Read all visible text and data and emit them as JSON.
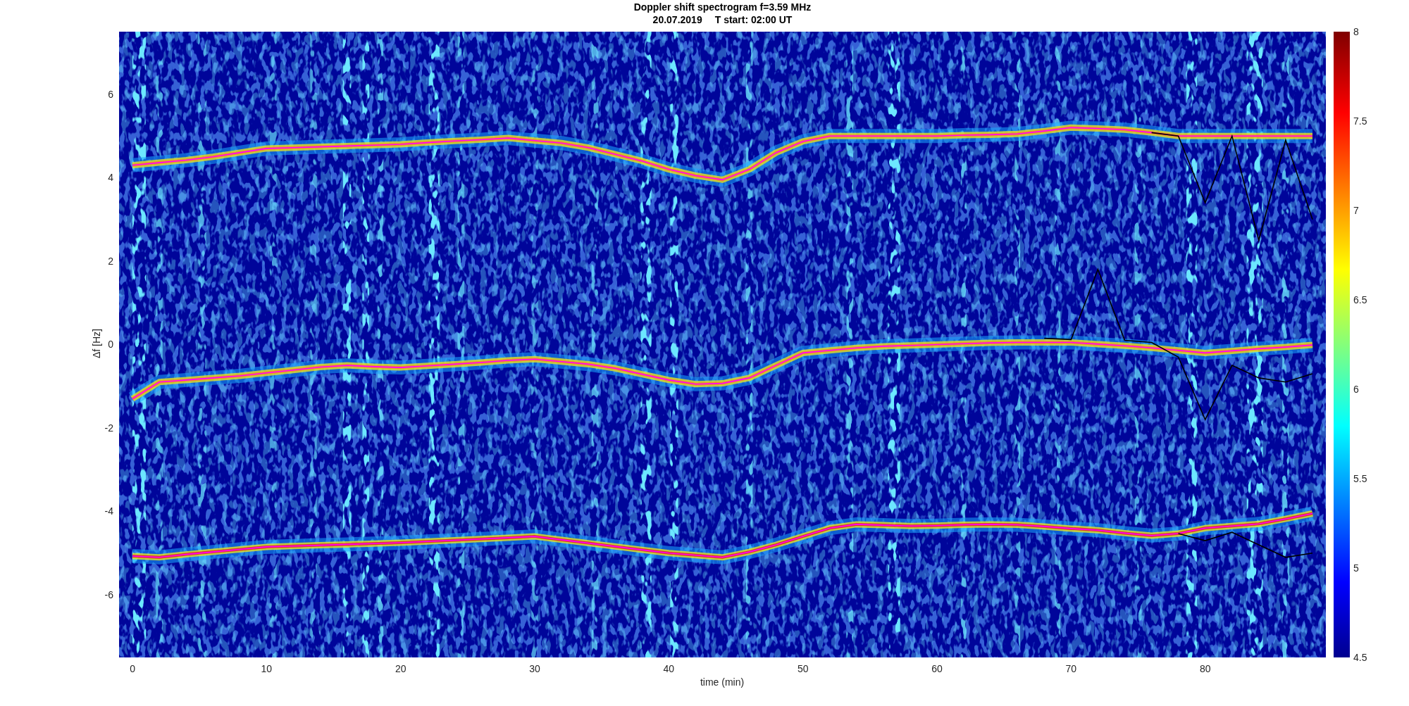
{
  "figure": {
    "date": "20.07.2019",
    "start": "T start: 02:00 UT"
  },
  "chart_data": {
    "type": "line",
    "title": "Doppler shift spectrogram f=3.59 MHz",
    "xlabel": "time (min)",
    "ylabel": "Δf [Hz]",
    "xlim": [
      -1,
      89
    ],
    "ylim": [
      -7.5,
      7.5
    ],
    "xticks": [
      0,
      10,
      20,
      30,
      40,
      50,
      60,
      70,
      80
    ],
    "yticks": [
      -6,
      -4,
      -2,
      0,
      2,
      4,
      6
    ],
    "x": [
      0,
      2,
      4,
      6,
      8,
      10,
      12,
      14,
      16,
      18,
      20,
      22,
      24,
      26,
      28,
      30,
      32,
      34,
      36,
      38,
      40,
      42,
      44,
      46,
      48,
      50,
      52,
      54,
      56,
      58,
      60,
      62,
      64,
      66,
      68,
      70,
      72,
      74,
      76,
      78,
      80,
      82,
      84,
      86,
      88
    ],
    "series": [
      {
        "color": "#ff00ff",
        "values": [
          4.3,
          4.36,
          4.42,
          4.5,
          4.6,
          4.7,
          4.72,
          4.74,
          4.76,
          4.78,
          4.8,
          4.84,
          4.88,
          4.91,
          4.95,
          4.89,
          4.83,
          4.72,
          4.56,
          4.4,
          4.2,
          4.05,
          3.95,
          4.2,
          4.6,
          4.87,
          5.0,
          5.0,
          5.0,
          5.0,
          5.0,
          5.02,
          5.03,
          5.05,
          5.12,
          5.2,
          5.18,
          5.15,
          5.08,
          5.0,
          5.0,
          5.0,
          5.0,
          5.0,
          5.0
        ]
      },
      {
        "color": "#ff00ff",
        "values": [
          -1.3,
          -0.9,
          -0.85,
          -0.8,
          -0.75,
          -0.68,
          -0.61,
          -0.54,
          -0.5,
          -0.53,
          -0.55,
          -0.51,
          -0.47,
          -0.43,
          -0.38,
          -0.35,
          -0.41,
          -0.47,
          -0.57,
          -0.71,
          -0.85,
          -0.95,
          -0.93,
          -0.8,
          -0.5,
          -0.2,
          -0.14,
          -0.08,
          -0.04,
          -0.02,
          0,
          0.02,
          0.04,
          0.05,
          0.05,
          0.05,
          0.01,
          -0.03,
          -0.08,
          -0.14,
          -0.2,
          -0.15,
          -0.1,
          -0.06,
          -0.01
        ]
      },
      {
        "color": "#ff00ff",
        "values": [
          -5.07,
          -5.1,
          -5.03,
          -4.97,
          -4.91,
          -4.85,
          -4.83,
          -4.81,
          -4.79,
          -4.77,
          -4.75,
          -4.72,
          -4.69,
          -4.66,
          -4.63,
          -4.6,
          -4.68,
          -4.76,
          -4.84,
          -4.92,
          -5.0,
          -5.05,
          -5.1,
          -4.97,
          -4.8,
          -4.6,
          -4.4,
          -4.31,
          -4.33,
          -4.35,
          -4.34,
          -4.32,
          -4.31,
          -4.32,
          -4.36,
          -4.41,
          -4.45,
          -4.52,
          -4.58,
          -4.53,
          -4.4,
          -4.35,
          -4.3,
          -4.18,
          -4.05
        ]
      },
      {
        "color": "#000000",
        "values": [
          null,
          null,
          null,
          null,
          null,
          null,
          null,
          null,
          null,
          null,
          null,
          null,
          null,
          null,
          null,
          null,
          null,
          null,
          null,
          null,
          null,
          null,
          null,
          null,
          null,
          null,
          null,
          null,
          null,
          null,
          null,
          null,
          null,
          null,
          null,
          null,
          null,
          null,
          5.08,
          5.0,
          3.4,
          5.0,
          2.5,
          4.9,
          3.0
        ]
      },
      {
        "color": "#000000",
        "values": [
          null,
          null,
          null,
          null,
          null,
          null,
          null,
          null,
          null,
          null,
          null,
          null,
          null,
          null,
          null,
          null,
          null,
          null,
          null,
          null,
          null,
          null,
          null,
          null,
          null,
          null,
          null,
          null,
          null,
          null,
          null,
          null,
          null,
          null,
          0.15,
          0.12,
          1.8,
          0.1,
          0.05,
          -0.3,
          -1.8,
          -0.5,
          -0.8,
          -0.9,
          -0.7
        ]
      },
      {
        "color": "#000000",
        "values": [
          null,
          null,
          null,
          null,
          null,
          null,
          null,
          null,
          null,
          null,
          null,
          null,
          null,
          null,
          null,
          null,
          null,
          null,
          null,
          null,
          null,
          null,
          null,
          null,
          null,
          null,
          null,
          null,
          null,
          null,
          null,
          null,
          null,
          null,
          null,
          null,
          null,
          null,
          null,
          -4.53,
          -4.7,
          -4.5,
          -4.8,
          -5.1,
          -5.0
        ]
      }
    ]
  },
  "colorbar": {
    "ticks": [
      "8",
      "7.5",
      "7",
      "6.5",
      "6",
      "5.5",
      "5",
      "4.5"
    ]
  }
}
